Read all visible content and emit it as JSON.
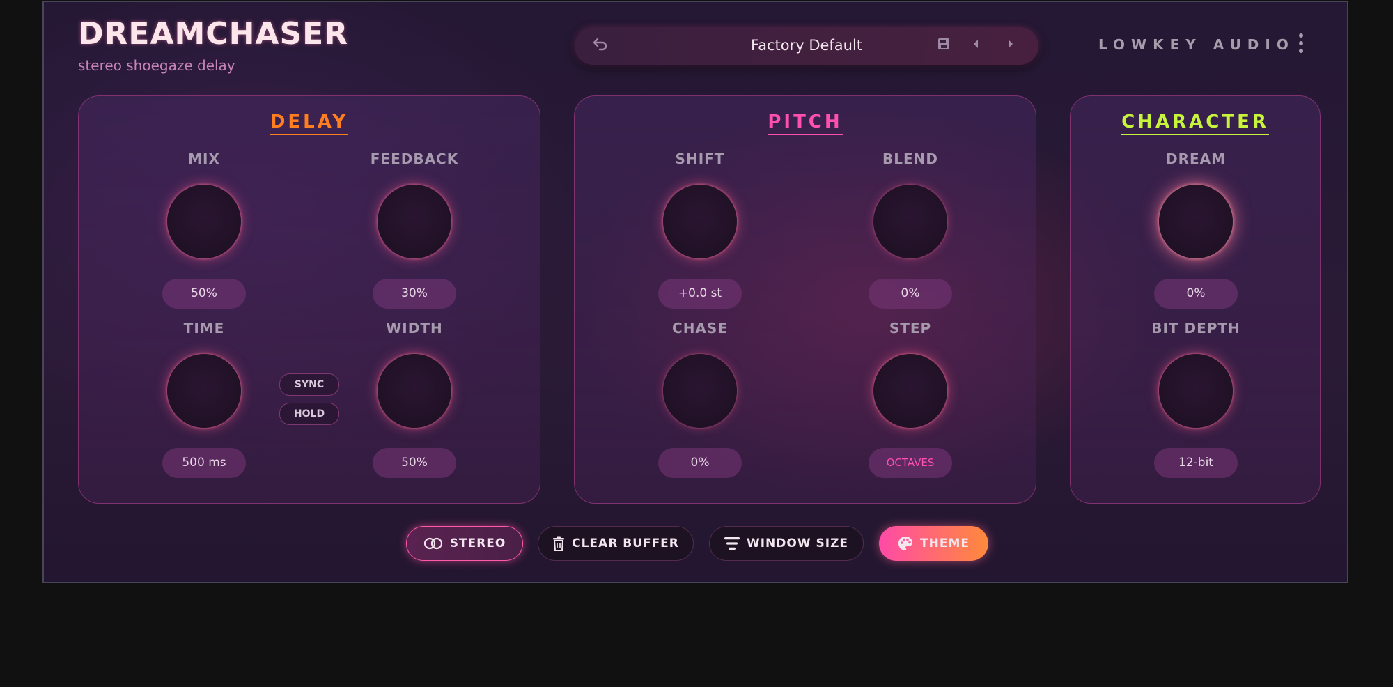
{
  "app": {
    "title": "DREAMCHASER",
    "subtitle": "stereo shoegaze delay",
    "brand": "LOWKEY AUDIO"
  },
  "preset": {
    "name": "Factory Default",
    "icons": [
      "undo-icon",
      "save-icon",
      "previous-preset-icon",
      "next-preset-icon"
    ]
  },
  "colors": {
    "delay": "#ff7e1f",
    "pitch": "#ff4fb0",
    "character": "#c8f53c",
    "accent_value": "#ff4fb0"
  },
  "panels": {
    "delay": {
      "title": "DELAY",
      "mix": {
        "label": "MIX",
        "value": "50%"
      },
      "feedback": {
        "label": "FEEDBACK",
        "value": "30%"
      },
      "time": {
        "label": "TIME",
        "value": "500 ms"
      },
      "width": {
        "label": "WIDTH",
        "value": "50%"
      },
      "sync_label": "SYNC",
      "hold_label": "HOLD"
    },
    "pitch": {
      "title": "PITCH",
      "shift": {
        "label": "SHIFT",
        "value": "+0.0 st"
      },
      "blend": {
        "label": "BLEND",
        "value": "0%"
      },
      "chase": {
        "label": "CHASE",
        "value": "0%"
      },
      "step": {
        "label": "STEP",
        "value": "OCTAVES"
      }
    },
    "character": {
      "title": "CHARACTER",
      "dream": {
        "label": "DREAM",
        "value": "0%"
      },
      "bit_depth": {
        "label": "BIT DEPTH",
        "value": "12-bit"
      }
    }
  },
  "footer": {
    "stereo": "STEREO",
    "clear_buffer": "CLEAR BUFFER",
    "window_size": "WINDOW SIZE",
    "theme": "THEME"
  }
}
